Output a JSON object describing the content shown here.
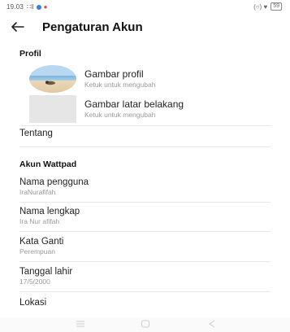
{
  "status": {
    "time": "19.03",
    "signal": "∷ll",
    "right": "(○) ♥",
    "battery": "59"
  },
  "header": {
    "back_icon": "arrow-left-icon",
    "title": "Pengaturan Akun"
  },
  "profil": {
    "heading": "Profil",
    "profile_picture": {
      "label": "Gambar profil",
      "sub": "Ketuk untuk mengubah"
    },
    "background_picture": {
      "label": "Gambar latar belakang",
      "sub": "Ketuk untuk mengubah"
    },
    "about": {
      "label": "Tentang"
    }
  },
  "akun": {
    "heading": "Akun Wattpad",
    "rows": [
      {
        "label": "Nama pengguna",
        "value": "IraNurafifah"
      },
      {
        "label": "Nama lengkap",
        "value": "Ira Nur afifah"
      },
      {
        "label": "Kata Ganti",
        "value": "Perempuan"
      },
      {
        "label": "Tanggal lahir",
        "value": "17/5/2000"
      },
      {
        "label": "Lokasi",
        "value": ""
      }
    ]
  },
  "navbar": {
    "icons": [
      "menu-icon",
      "home-square-icon",
      "back-triangle-icon"
    ]
  }
}
